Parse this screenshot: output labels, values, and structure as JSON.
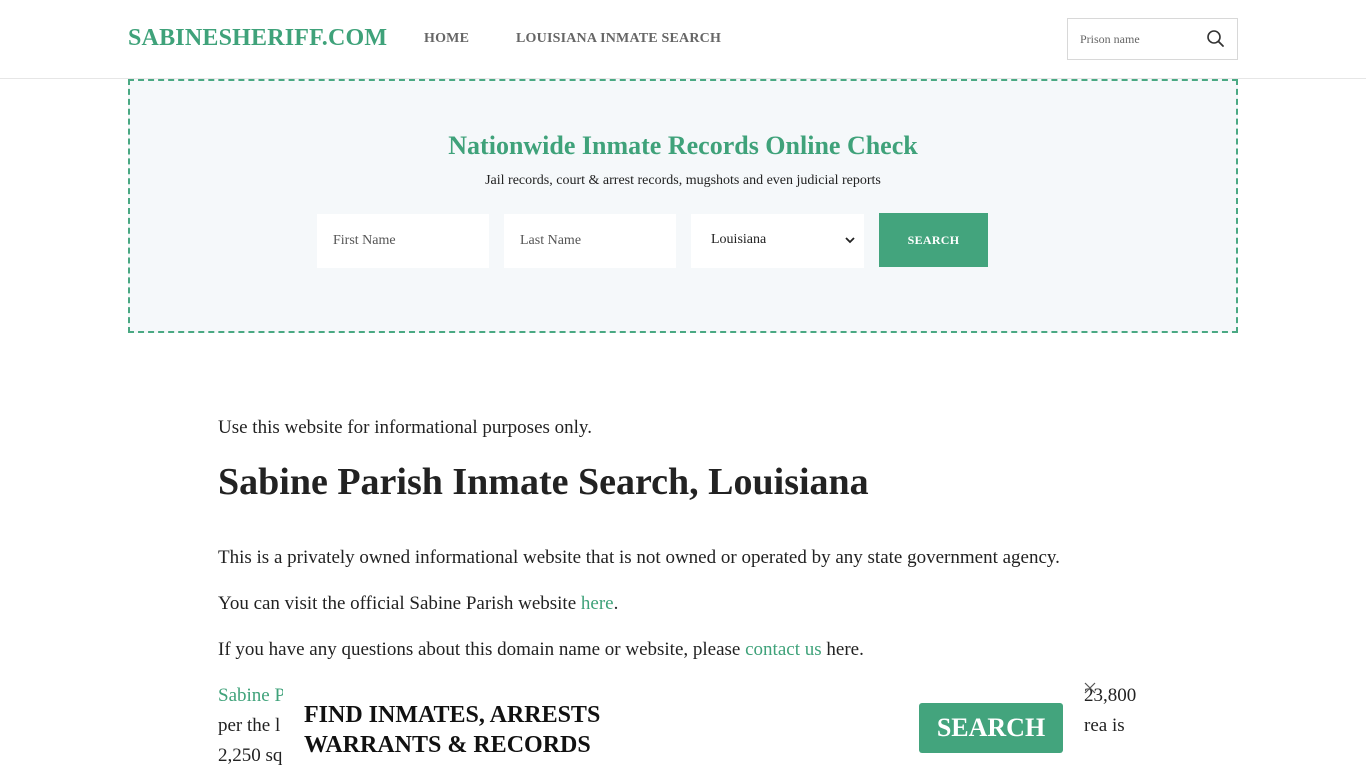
{
  "header": {
    "logo": "SABINESHERIFF.COM",
    "nav": [
      {
        "label": "HOME"
      },
      {
        "label": "LOUISIANA INMATE SEARCH"
      }
    ],
    "search": {
      "placeholder": "Prison name",
      "icon": "search-icon"
    }
  },
  "hero": {
    "title": "Nationwide Inmate Records Online Check",
    "subtitle": "Jail records, court & arrest records, mugshots and even judicial reports",
    "first_name_placeholder": "First Name",
    "last_name_placeholder": "Last Name",
    "state_selected": "Louisiana",
    "search_label": "SEARCH"
  },
  "content": {
    "notice": "Use this website for informational purposes only.",
    "title": "Sabine Parish Inmate Search, Louisiana",
    "p1": "This is a privately owned informational website that is not owned or operated by any state government agency.",
    "p2_pre": "You can visit the official Sabine Parish website ",
    "p2_link": "here",
    "p2_post": ".",
    "p3_pre": "If you have any questions about this domain name or website, please ",
    "p3_link": "contact us",
    "p3_post": " here.",
    "p4_start_link": "Sabine P",
    "p4_right_1": "23,800",
    "p4_line2_start": "per the l",
    "p4_line2_right": "rea is",
    "p4_line3_start": "2,250 sq"
  },
  "ad": {
    "text_line1": "FIND INMATES, ARRESTS",
    "text_line2": "WARRANTS & RECORDS",
    "button": "SEARCH",
    "close_icon": "close-icon"
  },
  "colors": {
    "accent": "#3fa27a",
    "button": "#43a47d",
    "hero_bg": "#f5f8fa"
  }
}
